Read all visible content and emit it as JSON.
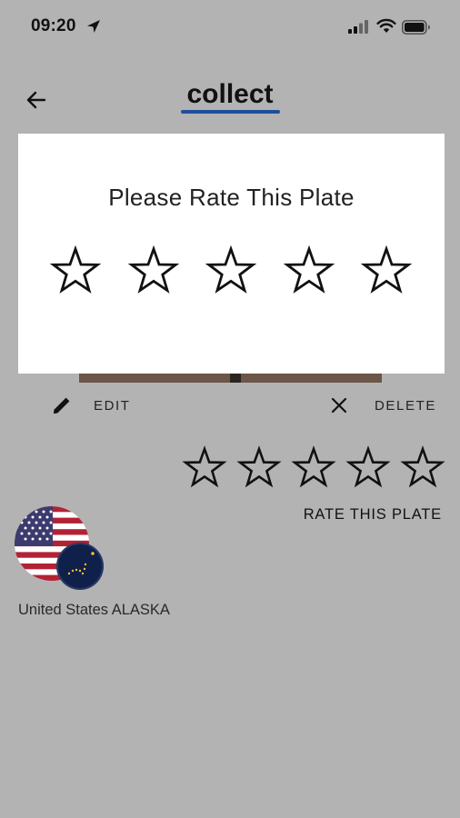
{
  "status_bar": {
    "time": "09:20",
    "icons": [
      "location-arrow-icon",
      "signal-icon",
      "wifi-icon",
      "battery-icon"
    ]
  },
  "header": {
    "title": "collect",
    "accent_color": "#1f4f9c",
    "back_icon": "arrow-left-icon"
  },
  "actions": {
    "edit_label": "EDIT",
    "edit_icon": "pencil-icon",
    "delete_label": "DELETE",
    "delete_icon": "close-icon"
  },
  "rating": {
    "stars_total": 5,
    "stars_filled": 0,
    "rate_label": "RATE THIS PLATE"
  },
  "plate": {
    "country": "United States ALASKA",
    "flags": [
      "us-flag",
      "alaska-flag"
    ]
  },
  "dialog": {
    "title": "Please Rate This Plate",
    "stars_total": 5,
    "stars_filled": 0
  },
  "colors": {
    "overlay_background": "#b3b3b3",
    "dialog_background": "#ffffff"
  }
}
